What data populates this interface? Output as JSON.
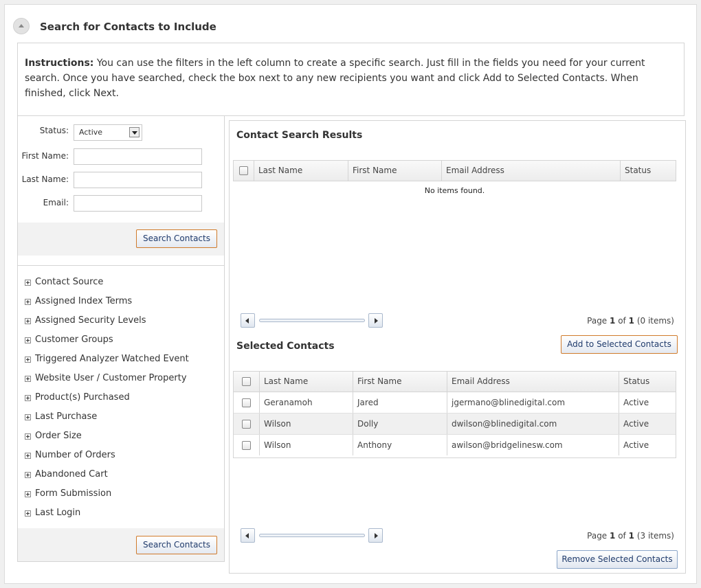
{
  "section": {
    "title": "Search for Contacts to Include"
  },
  "instructions": {
    "heading": "Instructions:",
    "text": " You can use the filters in the left column to create a specific search. Just fill in the fields you need for your current search. Once you have searched, check the box next to any new recipients you want and click Add to Selected Contacts. When finished, click Next."
  },
  "search_form": {
    "status_label": "Status:",
    "status_value": "Active",
    "first_name_label": "First Name:",
    "first_name_value": "",
    "last_name_label": "Last Name:",
    "last_name_value": "",
    "email_label": "Email:",
    "email_value": "",
    "search_button": "Search Contacts"
  },
  "filters": [
    "Contact Source",
    "Assigned Index Terms",
    "Assigned Security Levels",
    "Customer Groups",
    "Triggered Analyzer Watched Event",
    "Website User / Customer Property",
    "Product(s) Purchased",
    "Last Purchase",
    "Order Size",
    "Number of Orders",
    "Abandoned Cart",
    "Form Submission",
    "Last Login"
  ],
  "bottom_search_button": "Search Contacts",
  "results": {
    "title": "Contact Search Results",
    "columns": [
      "Last Name",
      "First Name",
      "Email Address",
      "Status"
    ],
    "empty_message": "No items found.",
    "pager": {
      "prefix": "Page",
      "page": "1",
      "of": "of",
      "total": "1",
      "items": "(0 items)"
    },
    "add_button": "Add to Selected Contacts"
  },
  "selected": {
    "title": "Selected Contacts",
    "columns": [
      "Last Name",
      "First Name",
      "Email Address",
      "Status"
    ],
    "rows": [
      {
        "last": "Geranamoh",
        "first": "Jared",
        "email": "jgermano@blinedigital.com",
        "status": "Active"
      },
      {
        "last": "Wilson",
        "first": "Dolly",
        "email": "dwilson@blinedigital.com",
        "status": "Active"
      },
      {
        "last": "Wilson",
        "first": "Anthony",
        "email": "awilson@bridgelinesw.com",
        "status": "Active"
      }
    ],
    "pager": {
      "prefix": "Page",
      "page": "1",
      "of": "of",
      "total": "1",
      "items": "(3 items)"
    },
    "remove_button": "Remove Selected Contacts"
  }
}
